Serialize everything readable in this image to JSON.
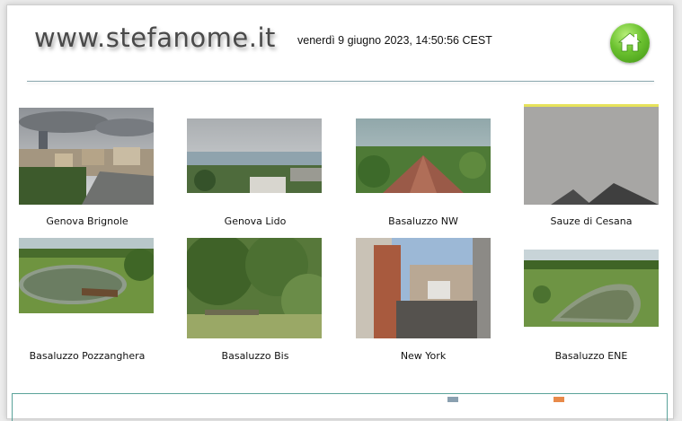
{
  "header": {
    "site_title": "www.stefanome.it",
    "datetime": "venerdì 9 giugno 2023, 14:50:56 CEST",
    "home_icon": "home-icon"
  },
  "webcams": [
    {
      "label": "Genova Brignole"
    },
    {
      "label": "Genova Lido"
    },
    {
      "label": "Basaluzzo NW"
    },
    {
      "label": "Sauze di Cesana"
    },
    {
      "label": "Basaluzzo Pozzanghera"
    },
    {
      "label": "Basaluzzo Bis"
    },
    {
      "label": "New York"
    },
    {
      "label": "Basaluzzo ENE"
    }
  ],
  "colors": {
    "home_button": "#5cb82a",
    "divider": "#8aa7ad",
    "bottom_border": "#5aa39a"
  }
}
